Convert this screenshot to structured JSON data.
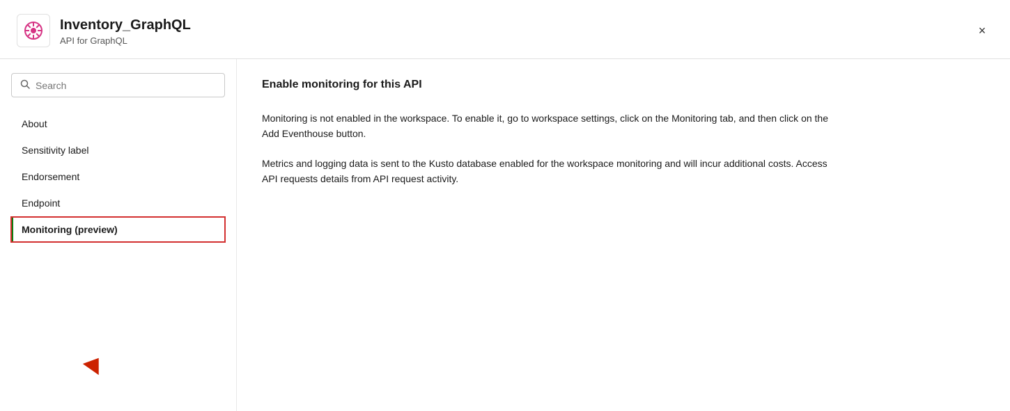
{
  "header": {
    "title": "Inventory_GraphQL",
    "subtitle": "API for GraphQL",
    "close_label": "×",
    "icon_alt": "GraphQL API icon"
  },
  "sidebar": {
    "search_placeholder": "Search",
    "nav_items": [
      {
        "id": "about",
        "label": "About",
        "active": false,
        "highlighted": false
      },
      {
        "id": "sensitivity-label",
        "label": "Sensitivity label",
        "active": false,
        "highlighted": false
      },
      {
        "id": "endorsement",
        "label": "Endorsement",
        "active": false,
        "highlighted": false
      },
      {
        "id": "endpoint",
        "label": "Endpoint",
        "active": false,
        "highlighted": false
      },
      {
        "id": "monitoring",
        "label": "Monitoring (preview)",
        "active": true,
        "highlighted": true
      }
    ]
  },
  "main": {
    "section_title": "Enable monitoring for this API",
    "paragraphs": [
      "Monitoring is not enabled in the workspace. To enable it, go to workspace settings, click on the Monitoring tab, and then click on the Add Eventhouse button.",
      "Metrics and logging data is sent to the Kusto database enabled for the workspace monitoring and will incur additional costs. Access API requests details from API request activity."
    ]
  }
}
